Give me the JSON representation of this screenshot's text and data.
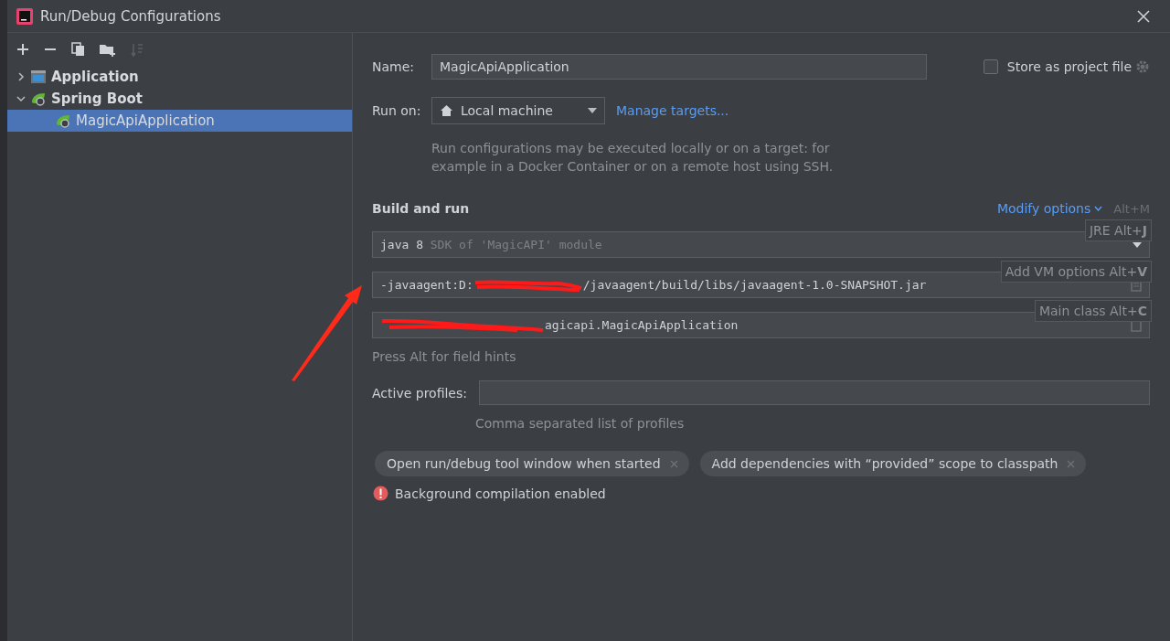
{
  "window": {
    "title": "Run/Debug Configurations"
  },
  "toolbar": [
    {
      "kind": "add",
      "disabled": false
    },
    {
      "kind": "remove",
      "disabled": false
    },
    {
      "kind": "copy",
      "disabled": false
    },
    {
      "kind": "folder",
      "disabled": false
    },
    {
      "kind": "sort",
      "disabled": true
    }
  ],
  "tree": [
    {
      "label": "Application",
      "kind": "application",
      "expanded": false,
      "selected": false
    },
    {
      "label": "Spring Boot",
      "kind": "spring",
      "expanded": true,
      "selected": false,
      "children": [
        {
          "label": "MagicApiApplication",
          "kind": "spring",
          "selected": true
        }
      ]
    }
  ],
  "name": {
    "label": "Name:",
    "value": "MagicApiApplication"
  },
  "store": {
    "label": "Store as project file",
    "checked": false
  },
  "run_on": {
    "label": "Run on:",
    "value": "Local machine",
    "link": "Manage targets..."
  },
  "run_on_help": "Run configurations may be executed locally or on a target: for example in a Docker Container or on a remote host using SSH.",
  "build": {
    "heading": "Build and run",
    "modify_options": "Modify options",
    "shortcut": "Alt+M",
    "jre": {
      "value": "java 8",
      "hint": "SDK of 'MagicAPI' module"
    },
    "vm_options": {
      "before": "-javaagent:D:",
      "after": "/javaagent/build/libs/javaagent-1.0-SNAPSHOT.jar",
      "redacted": true
    },
    "main_class": {
      "visible_text": "agicapi.MagicApiApplication",
      "redacted": true
    },
    "tooltips": [
      {
        "text": "JRE Alt+**J**"
      },
      {
        "text": "Add VM options Alt+**V**"
      },
      {
        "text": "Main class Alt+**C**"
      }
    ]
  },
  "field_hint": "Press Alt for field hints",
  "active_profiles": {
    "label": "Active profiles:",
    "hint": "Comma separated list of profiles"
  },
  "chips": [
    {
      "label": "Open run/debug tool window when started",
      "removable": true
    },
    {
      "label": "Add dependencies with “provided” scope to classpath",
      "removable": true
    }
  ],
  "warning": "Background compilation enabled",
  "annotation": {
    "kind": "arrow"
  }
}
